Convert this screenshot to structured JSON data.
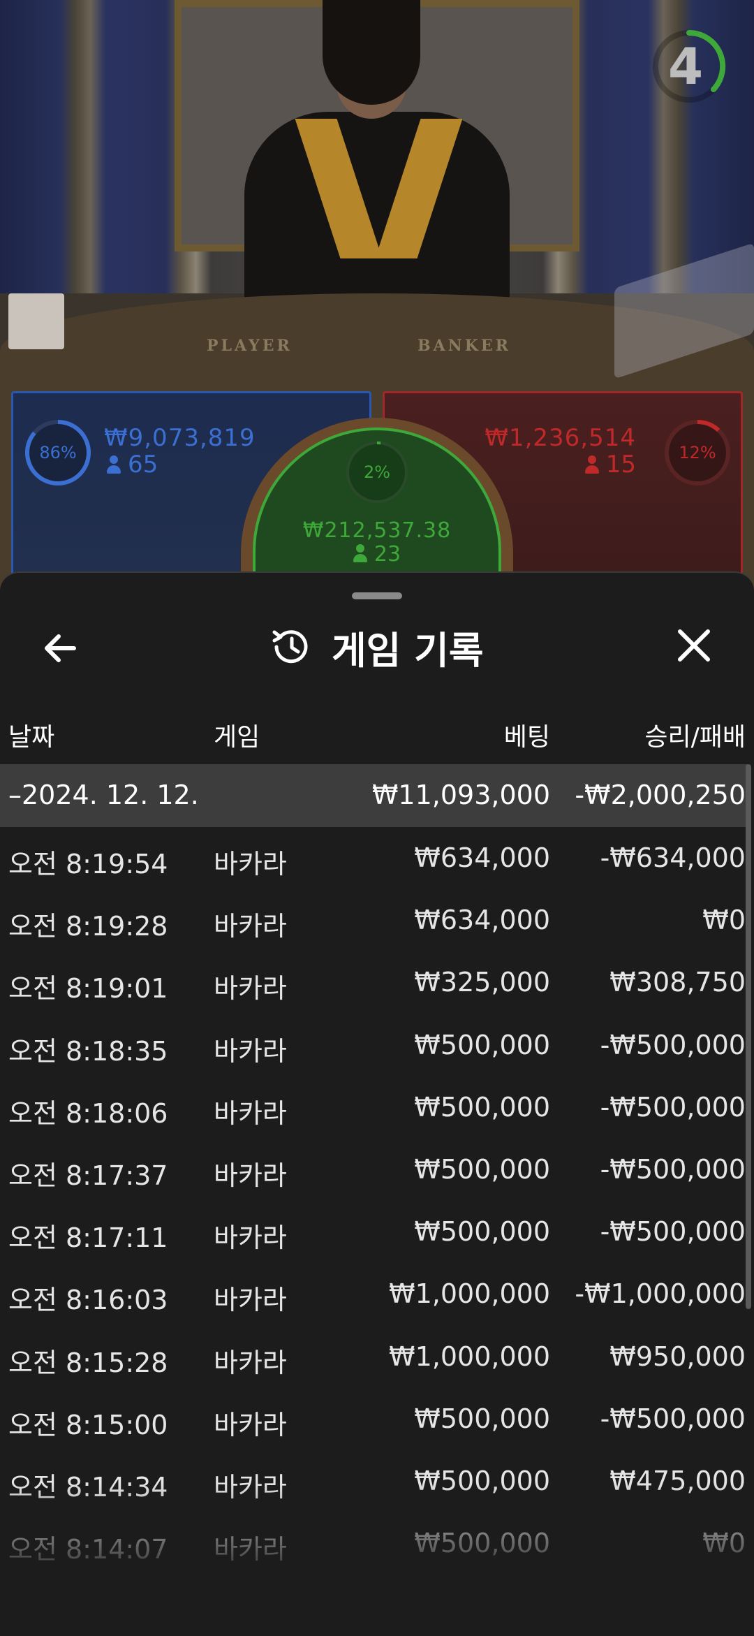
{
  "video": {
    "timer": "4",
    "table_labels": {
      "player": "PLAYER",
      "banker": "BANKER"
    }
  },
  "bets": {
    "player": {
      "percent_label": "86%",
      "percent": 86,
      "amount": "₩9,073,819",
      "count": "65",
      "color": "#3b6fd1"
    },
    "banker": {
      "percent_label": "12%",
      "percent": 12,
      "amount": "₩1,236,514",
      "count": "15",
      "color": "#c0292a"
    },
    "tie": {
      "percent_label": "2%",
      "percent": 2,
      "amount": "₩212,537.38",
      "count": "23",
      "color": "#3fa83a"
    }
  },
  "history": {
    "title": "게임 기록",
    "columns": {
      "date": "날짜",
      "game": "게임",
      "bet": "베팅",
      "profit": "승리/패배"
    },
    "day": {
      "date": "–2024. 12. 12.",
      "bet": "₩11,093,000",
      "profit": "-₩2,000,250"
    },
    "rows": [
      {
        "time": "오전 8:19:54",
        "game": "바카라",
        "bet": "₩634,000",
        "profit": "-₩634,000"
      },
      {
        "time": "오전 8:19:28",
        "game": "바카라",
        "bet": "₩634,000",
        "profit": "₩0"
      },
      {
        "time": "오전 8:19:01",
        "game": "바카라",
        "bet": "₩325,000",
        "profit": "₩308,750"
      },
      {
        "time": "오전 8:18:35",
        "game": "바카라",
        "bet": "₩500,000",
        "profit": "-₩500,000"
      },
      {
        "time": "오전 8:18:06",
        "game": "바카라",
        "bet": "₩500,000",
        "profit": "-₩500,000"
      },
      {
        "time": "오전 8:17:37",
        "game": "바카라",
        "bet": "₩500,000",
        "profit": "-₩500,000"
      },
      {
        "time": "오전 8:17:11",
        "game": "바카라",
        "bet": "₩500,000",
        "profit": "-₩500,000"
      },
      {
        "time": "오전 8:16:03",
        "game": "바카라",
        "bet": "₩1,000,000",
        "profit": "-₩1,000,000"
      },
      {
        "time": "오전 8:15:28",
        "game": "바카라",
        "bet": "₩1,000,000",
        "profit": "₩950,000"
      },
      {
        "time": "오전 8:15:00",
        "game": "바카라",
        "bet": "₩500,000",
        "profit": "-₩500,000"
      },
      {
        "time": "오전 8:14:34",
        "game": "바카라",
        "bet": "₩500,000",
        "profit": "₩475,000"
      },
      {
        "time": "오전 8:14:07",
        "game": "바카라",
        "bet": "₩500,000",
        "profit": "₩0"
      }
    ]
  }
}
